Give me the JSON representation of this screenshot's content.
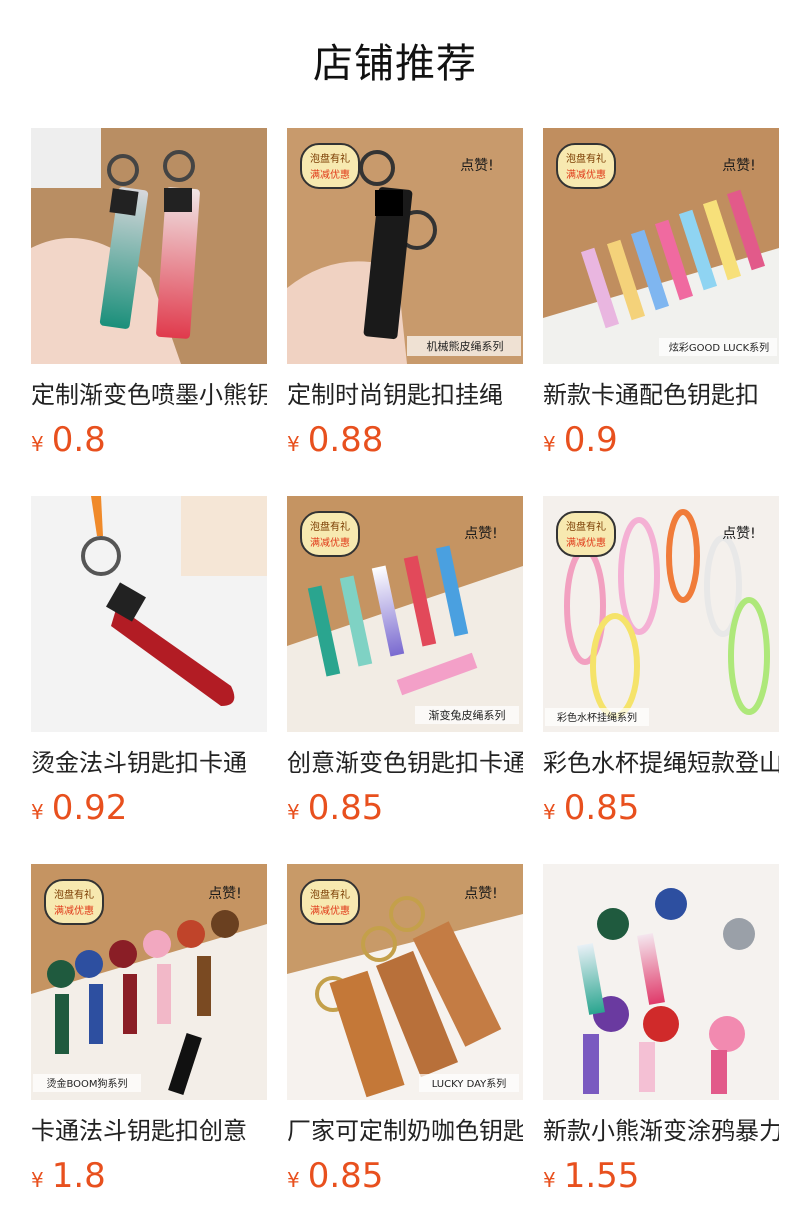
{
  "page": {
    "title": "店铺推荐"
  },
  "currency_symbol": "¥",
  "products": [
    {
      "name": "定制渐变色喷墨小熊钥匙扣",
      "price": "0.8",
      "image": "gradient-bear-strap-keychain-icon"
    },
    {
      "name": "定制时尚钥匙扣挂绳",
      "price": "0.88",
      "image": "black-strap-keychain-icon",
      "badges": [
        "泡盘有礼",
        "满减优惠",
        "点赞!"
      ],
      "caption": "机械熊皮绳系列"
    },
    {
      "name": "新款卡通配色钥匙扣",
      "price": "0.9",
      "image": "colorful-good-luck-keychains-icon",
      "badges": [
        "泡盘有礼",
        "满减优惠",
        "点赞!"
      ],
      "caption": "炫彩GOOD LUCK系列"
    },
    {
      "name": "烫金法斗钥匙扣卡通",
      "price": "0.92",
      "image": "red-boom-strap-keychain-icon"
    },
    {
      "name": "创意渐变色钥匙扣卡通",
      "price": "0.85",
      "image": "gradient-rabbit-keychains-icon",
      "badges": [
        "泡盘有礼",
        "满减优惠",
        "点赞!"
      ],
      "caption": "渐变兔皮绳系列"
    },
    {
      "name": "彩色水杯提绳短款登山扣",
      "price": "0.85",
      "image": "colorful-rope-keychains-icon",
      "badges": [
        "泡盘有礼",
        "满减优惠",
        "点赞!"
      ],
      "caption": "彩色水杯挂绳系列"
    },
    {
      "name": "卡通法斗钥匙扣创意",
      "price": "1.8",
      "image": "bulldog-figure-keychains-icon",
      "badges": [
        "泡盘有礼",
        "满减优惠",
        "点赞!"
      ],
      "caption": "烫金BOOM狗系列"
    },
    {
      "name": "厂家可定制奶咖色钥匙扣",
      "price": "0.85",
      "image": "tan-lucky-strap-keychains-icon",
      "badges": [
        "泡盘有礼",
        "满减优惠",
        "点赞!"
      ],
      "caption": "LUCKY DAY系列"
    },
    {
      "name": "新款小熊渐变涂鸦暴力熊",
      "price": "1.55",
      "image": "gradient-bear-figure-keychains-icon"
    }
  ]
}
